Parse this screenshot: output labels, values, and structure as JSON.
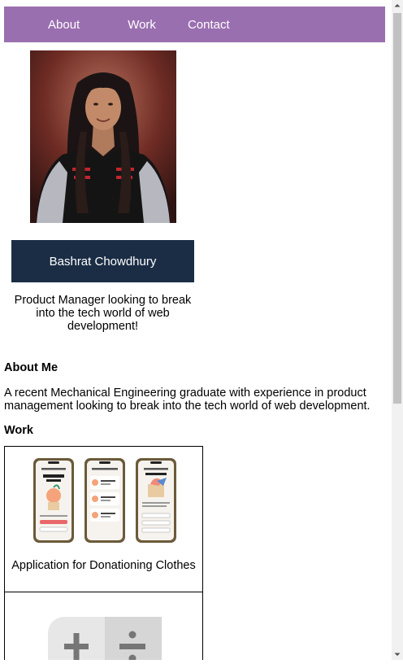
{
  "nav": {
    "about": "About",
    "work": "Work",
    "contact": "Contact"
  },
  "profile": {
    "name": "Bashrat Chowdhury",
    "tagline": "Product Manager looking to break into the tech world of web development!"
  },
  "about": {
    "heading": "About Me",
    "text": "A recent Mechanical Engineering graduate with experience in product management looking to break into the tech world of web development."
  },
  "work": {
    "heading": "Work",
    "projects": [
      {
        "caption": "Application for Donationing Clothes"
      }
    ]
  },
  "colors": {
    "navbar": "#9a6fb0",
    "name_box": "#1b2d45"
  }
}
